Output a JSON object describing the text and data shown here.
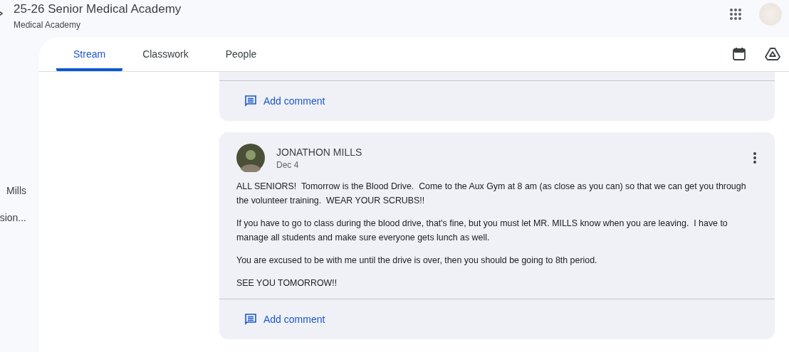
{
  "header": {
    "title": "25-26 Senior Medical Academy",
    "subtitle": "Medical Academy"
  },
  "sidebar": {
    "items": [
      {
        "label": "Mills"
      },
      {
        "label": "sion..."
      }
    ]
  },
  "tabs": [
    {
      "label": "Stream",
      "selected": true
    },
    {
      "label": "Classwork",
      "selected": false
    },
    {
      "label": "People",
      "selected": false
    }
  ],
  "posts": [
    {
      "kind": "partial",
      "comment_label": "Add comment"
    },
    {
      "kind": "full",
      "author": "JONATHON MILLS",
      "date": "Dec 4",
      "paragraphs": [
        "ALL SENIORS!  Tomorrow is the Blood Drive.  Come to the Aux Gym at 8 am (as close as you can) so that we can get you through the volunteer training.  WEAR YOUR SCRUBS!!",
        "If you have to go to class during the blood drive, that's fine, but you must let MR. MILLS know when you are leaving.  I have to manage all students and make sure everyone gets lunch as well.",
        "You are excused to be with me until the drive is over, then you should be going to 8th period.",
        "SEE YOU TOMORROW!!"
      ],
      "comment_label": "Add comment"
    }
  ]
}
